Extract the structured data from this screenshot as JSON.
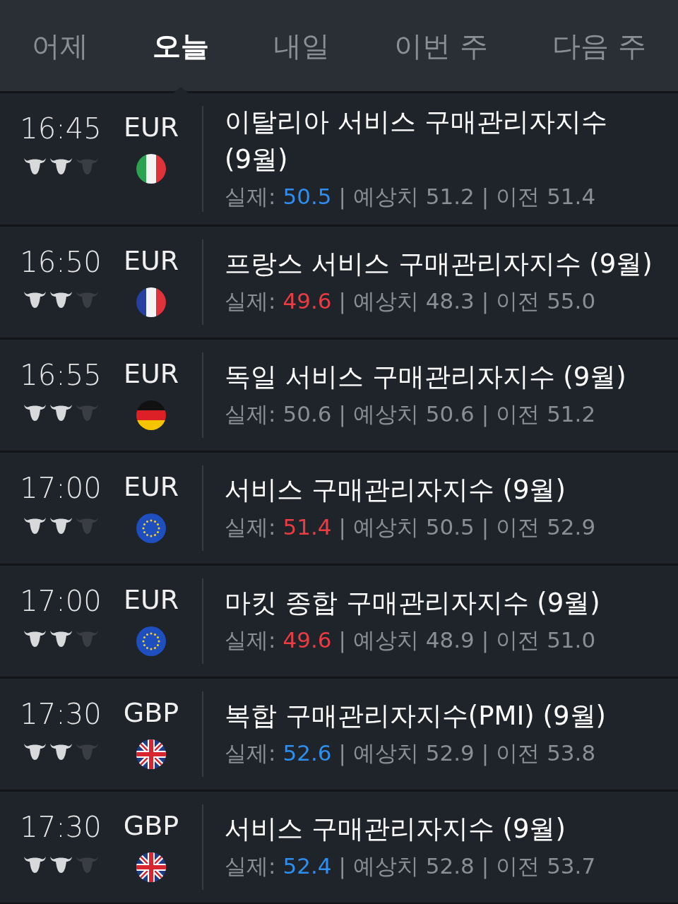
{
  "tabs": [
    {
      "label": "어제",
      "selected": false
    },
    {
      "label": "오늘",
      "selected": true
    },
    {
      "label": "내일",
      "selected": false
    },
    {
      "label": "이번 주",
      "selected": false
    },
    {
      "label": "다음 주",
      "selected": false
    }
  ],
  "events": [
    {
      "time": "16:45",
      "stars": 2,
      "currency": "EUR",
      "kind": "it",
      "title": "이탈리아 서비스 구매관리자지수 (9월)",
      "actual_label": "실제:",
      "actual": "50.5",
      "color": "#2f8ff0",
      "separator": "|",
      "forecast": "예상치 51.2",
      "previous": "이전 51.4"
    },
    {
      "time": "16:50",
      "stars": 2,
      "currency": "EUR",
      "kind": "fr",
      "title": "프랑스 서비스 구매관리자지수 (9월)",
      "actual_label": "실제:",
      "actual": "49.6",
      "color": "#ec3c43",
      "separator": "|",
      "forecast": "예상치 48.3",
      "previous": "이전 55.0"
    },
    {
      "time": "16:55",
      "stars": 2,
      "currency": "EUR",
      "kind": "de",
      "title": "독일 서비스 구매관리자지수 (9월)",
      "actual_label": "실제:",
      "actual": "50.6",
      "color": "#8b8e93",
      "separator": "|",
      "forecast": "예상치 50.6",
      "previous": "이전 51.2"
    },
    {
      "time": "17:00",
      "stars": 2,
      "currency": "EUR",
      "kind": "eu",
      "title": "서비스 구매관리자지수 (9월)",
      "actual_label": "실제:",
      "actual": "51.4",
      "color": "#ec3c43",
      "separator": "|",
      "forecast": "예상치 50.5",
      "previous": "이전 52.9"
    },
    {
      "time": "17:00",
      "stars": 2,
      "currency": "EUR",
      "kind": "eu",
      "title": "마킷 종합 구매관리자지수 (9월)",
      "actual_label": "실제:",
      "actual": "49.6",
      "color": "#ec3c43",
      "separator": "|",
      "forecast": "예상치 48.9",
      "previous": "이전 51.0"
    },
    {
      "time": "17:30",
      "stars": 2,
      "currency": "GBP",
      "kind": "gb",
      "title": "복합 구매관리자지수(PMI) (9월)",
      "actual_label": "실제:",
      "actual": "52.6",
      "color": "#2f8ff0",
      "separator": "|",
      "forecast": "예상치 52.9",
      "previous": "이전 53.8"
    },
    {
      "time": "17:30",
      "stars": 2,
      "currency": "GBP",
      "kind": "gb",
      "title": "서비스 구매관리자지수 (9월)",
      "actual_label": "실제:",
      "actual": "52.4",
      "color": "#2f8ff0",
      "separator": "|",
      "forecast": "예상치 52.8",
      "previous": "이전 53.7"
    }
  ]
}
